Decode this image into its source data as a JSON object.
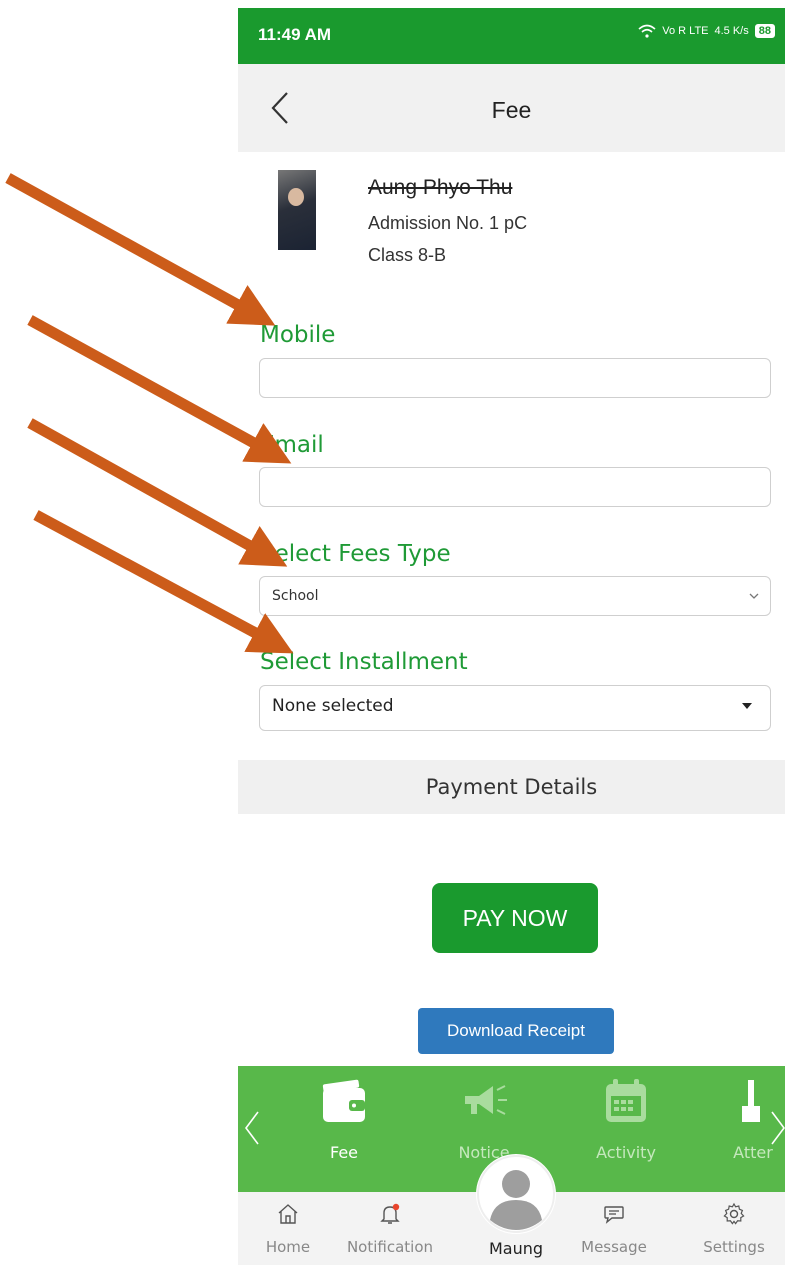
{
  "status_bar": {
    "time": "11:49 AM",
    "network": "Vo R LTE",
    "speed": "4.5 K/s",
    "battery": "88"
  },
  "header": {
    "title": "Fee"
  },
  "profile": {
    "name": "Aung Phyo Thu",
    "admission": "Admission No. 1 pC",
    "class": "Class 8-B"
  },
  "form": {
    "mobile_label": "Mobile",
    "mobile_value": "",
    "email_label": "Email",
    "email_value": "",
    "fees_type_label": "Select Fees Type",
    "fees_type_value": "School",
    "installment_label": "Select Installment",
    "installment_value": "None selected"
  },
  "payment_details_label": "Payment Details",
  "pay_now_label": "PAY NOW",
  "download_receipt_label": "Download Receipt",
  "carousel": {
    "items": [
      {
        "label": "Fee",
        "icon": "wallet-icon"
      },
      {
        "label": "Notice",
        "icon": "megaphone-icon"
      },
      {
        "label": "Activity",
        "icon": "calendar-icon"
      },
      {
        "label": "Atter",
        "icon": "attendance-icon"
      }
    ]
  },
  "bottom_nav": {
    "items": [
      {
        "label": "Home",
        "icon": "home-icon"
      },
      {
        "label": "Notification",
        "icon": "bell-icon"
      },
      {
        "label": "Maung",
        "icon": "user-avatar-icon"
      },
      {
        "label": "Message",
        "icon": "chat-icon"
      },
      {
        "label": "Settings",
        "icon": "gear-icon"
      }
    ]
  },
  "colors": {
    "primary_green": "#1a9a2e",
    "carousel_green": "#58b84a",
    "receipt_blue": "#2f79bd",
    "annotation_orange": "#cc5c1a"
  }
}
